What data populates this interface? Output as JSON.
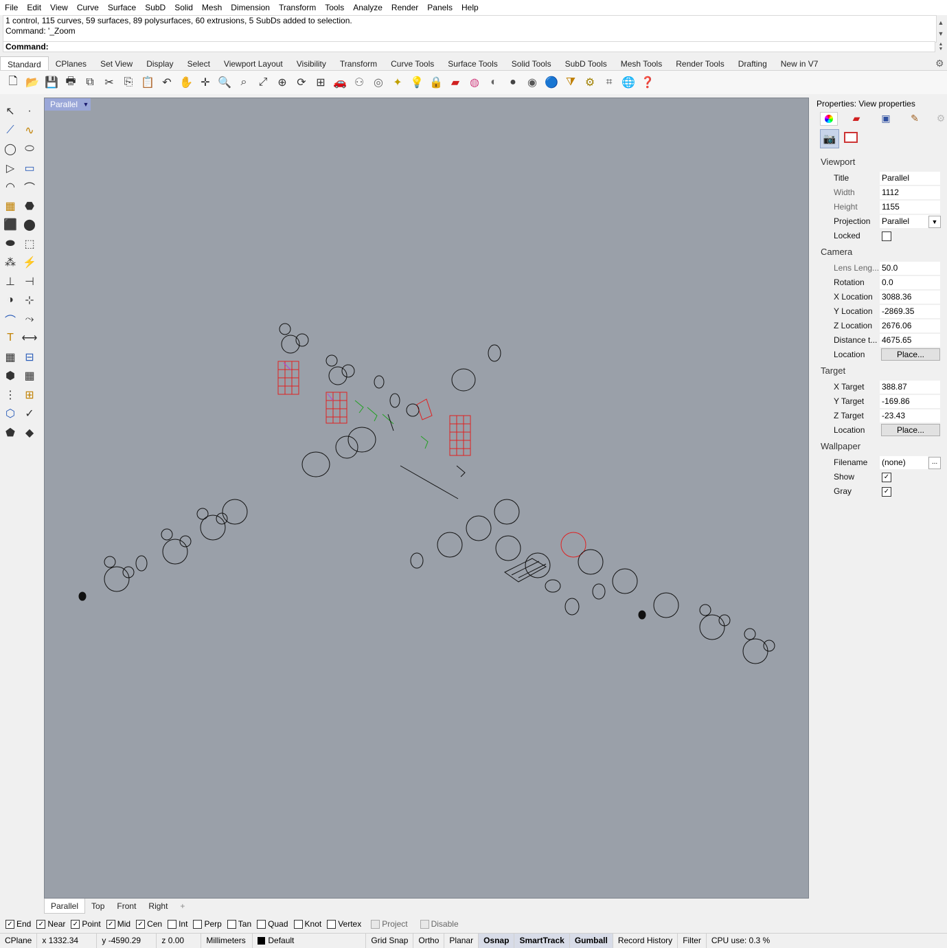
{
  "menu": [
    "File",
    "Edit",
    "View",
    "Curve",
    "Surface",
    "SubD",
    "Solid",
    "Mesh",
    "Dimension",
    "Transform",
    "Tools",
    "Analyze",
    "Render",
    "Panels",
    "Help"
  ],
  "command": {
    "history": [
      "1 control, 115 curves, 59 surfaces, 89 polysurfaces, 60 extrusions, 5 SubDs added to selection.",
      "Command: '_Zoom"
    ],
    "prompt": "Command:"
  },
  "toolbar_tabs": [
    "Standard",
    "CPlanes",
    "Set View",
    "Display",
    "Select",
    "Viewport Layout",
    "Visibility",
    "Transform",
    "Curve Tools",
    "Surface Tools",
    "Solid Tools",
    "SubD Tools",
    "Mesh Tools",
    "Render Tools",
    "Drafting",
    "New in V7"
  ],
  "toolbar_icons": [
    "new-icon",
    "open-icon",
    "save-icon",
    "print-icon",
    "import-icon",
    "cut-icon",
    "copy-icon",
    "paste-icon",
    "undo-icon",
    "pan-icon",
    "rotate-view-icon",
    "zoom-icon",
    "zoom-window-icon",
    "zoom-extents-icon",
    "zoom-selected-icon",
    "rotate-icon",
    "four-view-icon",
    "car-icon",
    "named-view-icon",
    "cplane-icon",
    "lights-icon",
    "lightbulb-icon",
    "lock-icon",
    "layer-icon",
    "color-wheel-icon",
    "sphere-wireframe-icon",
    "sphere-shaded-icon",
    "sphere-rendered-icon",
    "sphere-blue-icon",
    "filter-icon",
    "gear-icon",
    "options-icon",
    "globe-icon",
    "help-icon"
  ],
  "left_tools": [
    "select-icon",
    "point-icon",
    "polyline-icon",
    "curve-icon",
    "circle-icon",
    "ellipse-icon",
    "polygon-icon",
    "rectangle-icon",
    "arc-icon",
    "fillet-icon",
    "surface-icon",
    "sweep-icon",
    "box-icon",
    "sphere-icon",
    "cylinder-icon",
    "extrude-icon",
    "transform-icon",
    "explode-icon",
    "move-icon",
    "trim-icon",
    "boolean-icon",
    "split-icon",
    "offset-icon",
    "blend-icon",
    "text-icon",
    "dimension-icon",
    "group-icon",
    "array-icon",
    "solid-icon",
    "grid-icon",
    "matrix-icon",
    "mesh-icon",
    "layout-icon",
    "check-icon",
    "render-icon",
    "paint-icon"
  ],
  "viewport": {
    "title": "Parallel",
    "tabs": [
      "Parallel",
      "Top",
      "Front",
      "Right"
    ],
    "add_tab": "+"
  },
  "osnaps": [
    {
      "label": "End",
      "checked": true
    },
    {
      "label": "Near",
      "checked": true
    },
    {
      "label": "Point",
      "checked": true
    },
    {
      "label": "Mid",
      "checked": true
    },
    {
      "label": "Cen",
      "checked": true
    },
    {
      "label": "Int",
      "checked": false
    },
    {
      "label": "Perp",
      "checked": false
    },
    {
      "label": "Tan",
      "checked": false
    },
    {
      "label": "Quad",
      "checked": false
    },
    {
      "label": "Knot",
      "checked": false
    },
    {
      "label": "Vertex",
      "checked": false
    },
    {
      "label": "Project",
      "checked": false,
      "disabled": true
    },
    {
      "label": "Disable",
      "checked": false,
      "disabled": true
    }
  ],
  "status": {
    "cplane": "CPlane",
    "x": "x 1332.34",
    "y": "y -4590.29",
    "z": "z 0.00",
    "units": "Millimeters",
    "layer": "Default",
    "grid_snap": "Grid Snap",
    "ortho": "Ortho",
    "planar": "Planar",
    "osnap": "Osnap",
    "smarttrack": "SmartTrack",
    "gumball": "Gumball",
    "record_history": "Record History",
    "filter": "Filter",
    "cpu": "CPU use: 0.3 %"
  },
  "properties": {
    "title": "Properties: View properties",
    "viewport_header": "Viewport",
    "title_label": "Title",
    "title_value": "Parallel",
    "width_label": "Width",
    "width_value": "1112",
    "height_label": "Height",
    "height_value": "1155",
    "projection_label": "Projection",
    "projection_value": "Parallel",
    "locked_label": "Locked",
    "locked": false,
    "camera_header": "Camera",
    "lens_label": "Lens Leng...",
    "lens_value": "50.0",
    "rotation_label": "Rotation",
    "rotation_value": "0.0",
    "xloc_label": "X Location",
    "xloc_value": "3088.36",
    "yloc_label": "Y Location",
    "yloc_value": "-2869.35",
    "zloc_label": "Z Location",
    "zloc_value": "2676.06",
    "dist_label": "Distance t...",
    "dist_value": "4675.65",
    "camloc_label": "Location",
    "place_button": "Place...",
    "target_header": "Target",
    "xtar_label": "X Target",
    "xtar_value": "388.87",
    "ytar_label": "Y Target",
    "ytar_value": "-169.86",
    "ztar_label": "Z Target",
    "ztar_value": "-23.43",
    "tarloc_label": "Location",
    "wallpaper_header": "Wallpaper",
    "filename_label": "Filename",
    "filename_value": "(none)",
    "browse_button": "...",
    "show_label": "Show",
    "show": true,
    "gray_label": "Gray",
    "gray": true
  },
  "colors": {
    "viewport_bg": "#9aa0a9",
    "viewport_title_bg": "#9aa7d8",
    "selection_red": "#e02020",
    "selection_green": "#20a020",
    "wire_black": "#111111"
  }
}
